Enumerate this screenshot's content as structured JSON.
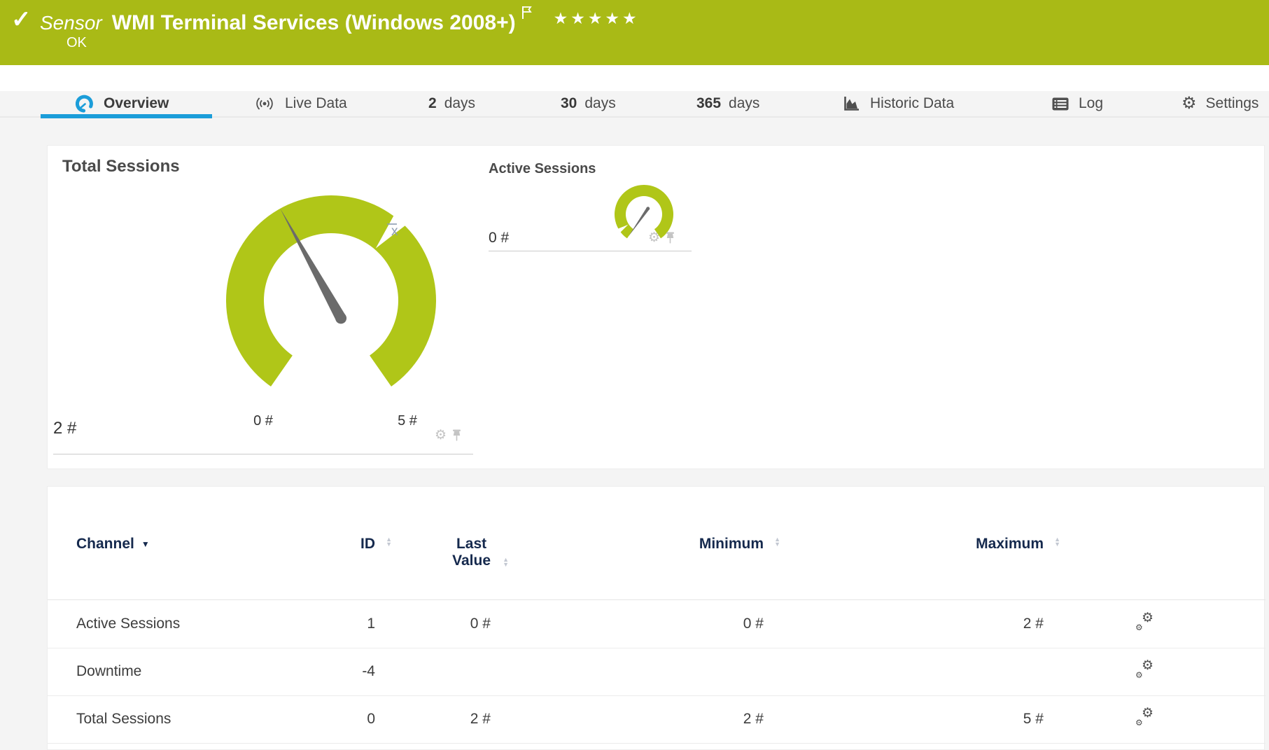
{
  "banner": {
    "status_glyph": "✓",
    "kind": "Sensor",
    "title": "WMI Terminal Services (Windows 2008+)",
    "status": "OK",
    "stars": "★★★★★",
    "bg_color": "#a9ba16"
  },
  "tabs": [
    {
      "label": "Overview",
      "icon": "gauge-icon",
      "active": true
    },
    {
      "label": "Live Data",
      "icon": "live-data-icon",
      "active": false
    },
    {
      "num": "2",
      "label": "days",
      "active": false
    },
    {
      "num": "30",
      "label": "days",
      "active": false
    },
    {
      "num": "365",
      "label": "days",
      "active": false
    },
    {
      "label": "Historic Data",
      "icon": "historic-data-icon",
      "active": false
    },
    {
      "label": "Log",
      "icon": "log-icon",
      "active": false
    },
    {
      "label": "Settings",
      "icon": "gear-icon",
      "active": false
    }
  ],
  "accent_colors": {
    "active_tab_blue": "#1b9dd9",
    "gauge_green": "#b0c618",
    "table_header_navy": "#15294d"
  },
  "gauges": [
    {
      "title": "Total Sessions",
      "value_label": "2 #",
      "value": 2,
      "min": 0,
      "max": 5,
      "min_label": "0 #",
      "max_label": "5 #",
      "average": 3.2,
      "average_marker": "x",
      "color": "#b0c618"
    },
    {
      "title": "Active Sessions",
      "value_label": "0 #",
      "value": 0,
      "min": 0,
      "max": 2,
      "average": 0.15,
      "color": "#b0c618"
    }
  ],
  "channel_table": {
    "headers": {
      "channel": "Channel",
      "id": "ID",
      "last_value_line1": "Last",
      "last_value_line2": "Value",
      "minimum": "Minimum",
      "maximum": "Maximum"
    },
    "rows": [
      {
        "channel": "Active Sessions",
        "id": "1",
        "last_value": "0 #",
        "minimum": "0 #",
        "maximum": "2 #"
      },
      {
        "channel": "Downtime",
        "id": "-4",
        "last_value": "",
        "minimum": "",
        "maximum": ""
      },
      {
        "channel": "Total Sessions",
        "id": "0",
        "last_value": "2 #",
        "minimum": "2 #",
        "maximum": "5 #"
      }
    ]
  },
  "chart_data": [
    {
      "type": "gauge",
      "title": "Total Sessions",
      "value": 2,
      "min": 0,
      "max": 5,
      "average": 3.2,
      "unit": "#"
    },
    {
      "type": "gauge",
      "title": "Active Sessions",
      "value": 0,
      "min": 0,
      "max": 2,
      "average": 0.15,
      "unit": "#"
    }
  ]
}
